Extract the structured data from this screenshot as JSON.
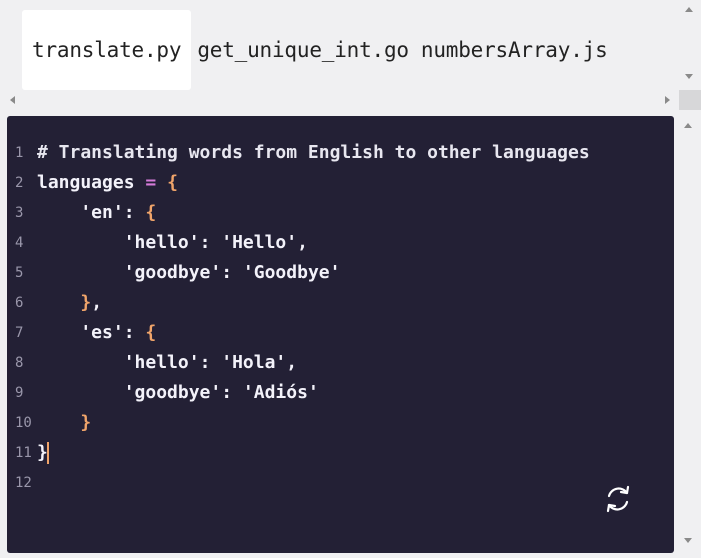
{
  "tabs": [
    {
      "label": "translate.py",
      "active": true
    },
    {
      "label": "get_unique_int.go",
      "active": false
    },
    {
      "label": "numbersArray.js",
      "active": false
    }
  ],
  "icons": {
    "refresh": "refresh-icon",
    "scroll_up": "chevron-up-icon",
    "scroll_down": "chevron-down-icon",
    "scroll_left": "chevron-left-icon",
    "scroll_right": "chevron-right-icon"
  },
  "editor": {
    "language": "python",
    "lines": [
      {
        "num": "1",
        "tokens": [
          {
            "t": "# Translating words from English to other languages",
            "k": "comment"
          }
        ]
      },
      {
        "num": "2",
        "tokens": [
          {
            "t": "languages ",
            "k": "plain"
          },
          {
            "t": "=",
            "k": "op"
          },
          {
            "t": " ",
            "k": "plain"
          },
          {
            "t": "{",
            "k": "brace"
          }
        ]
      },
      {
        "num": "3",
        "tokens": [
          {
            "t": "    'en'",
            "k": "str"
          },
          {
            "t": ": ",
            "k": "plain"
          },
          {
            "t": "{",
            "k": "brace"
          }
        ]
      },
      {
        "num": "4",
        "tokens": [
          {
            "t": "        'hello'",
            "k": "str"
          },
          {
            "t": ": ",
            "k": "plain"
          },
          {
            "t": "'Hello'",
            "k": "str"
          },
          {
            "t": ",",
            "k": "plain"
          }
        ]
      },
      {
        "num": "5",
        "tokens": [
          {
            "t": "        'goodbye'",
            "k": "str"
          },
          {
            "t": ": ",
            "k": "plain"
          },
          {
            "t": "'Goodbye'",
            "k": "str"
          }
        ]
      },
      {
        "num": "6",
        "tokens": [
          {
            "t": "    ",
            "k": "plain"
          },
          {
            "t": "}",
            "k": "brace"
          },
          {
            "t": ",",
            "k": "plain"
          }
        ]
      },
      {
        "num": "7",
        "tokens": [
          {
            "t": "    'es'",
            "k": "str"
          },
          {
            "t": ": ",
            "k": "plain"
          },
          {
            "t": "{",
            "k": "brace"
          }
        ]
      },
      {
        "num": "8",
        "tokens": [
          {
            "t": "        'hello'",
            "k": "str"
          },
          {
            "t": ": ",
            "k": "plain"
          },
          {
            "t": "'Hola'",
            "k": "str"
          },
          {
            "t": ",",
            "k": "plain"
          }
        ]
      },
      {
        "num": "9",
        "tokens": [
          {
            "t": "        'goodbye'",
            "k": "str"
          },
          {
            "t": ": ",
            "k": "plain"
          },
          {
            "t": "'Adiós'",
            "k": "str"
          }
        ]
      },
      {
        "num": "10",
        "tokens": [
          {
            "t": "    ",
            "k": "plain"
          },
          {
            "t": "}",
            "k": "brace"
          }
        ]
      },
      {
        "num": "11",
        "tokens": [
          {
            "t": "}",
            "k": "plain"
          }
        ]
      },
      {
        "num": "12",
        "tokens": []
      }
    ],
    "cursor_line": "11"
  },
  "colors": {
    "editor_background": "#232035",
    "comment": "#e8e7f0",
    "operator": "#d57bd9",
    "brace": "#f0a46a",
    "text": "#f3f2fa",
    "line_number": "#9a97ab",
    "cursor": "#f0a46a"
  }
}
